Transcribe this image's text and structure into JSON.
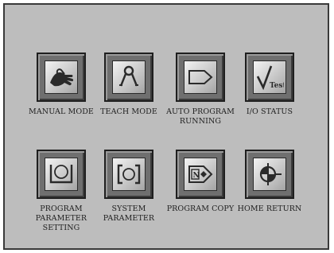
{
  "menu": {
    "buttons": [
      {
        "label": "MANUAL MODE",
        "icon": "hand-icon"
      },
      {
        "label": "TEACH MODE",
        "icon": "teach-pendant-icon"
      },
      {
        "label": "AUTO PROGRAM\nRUNNING",
        "icon": "arrow-box-icon"
      },
      {
        "label": "I/O STATUS",
        "icon": "checkmark-test-icon",
        "icon_text": "Test"
      },
      {
        "label": "PROGRAM\nPARAMETER\nSETTING",
        "icon": "tray-icon"
      },
      {
        "label": "SYSTEM\nPARAMETER",
        "icon": "bracket-box-icon"
      },
      {
        "label": "PROGRAM COPY",
        "icon": "copy-arrow-icon",
        "icon_text": "N"
      },
      {
        "label": "HOME RETURN",
        "icon": "home-target-icon"
      }
    ]
  }
}
